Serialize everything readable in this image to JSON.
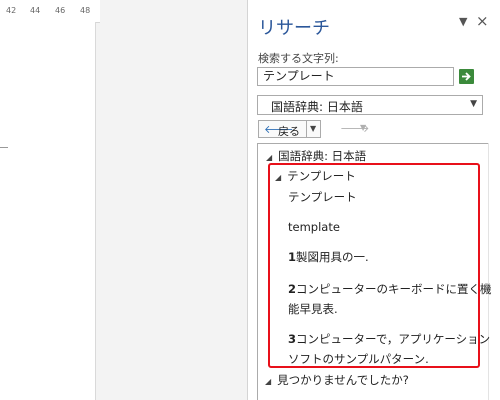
{
  "ruler": {
    "ticks": [
      "42",
      "44",
      "46",
      "48"
    ]
  },
  "pane": {
    "title": "リサーチ",
    "menu_glyph": "▼",
    "close_glyph": "×"
  },
  "search": {
    "label": "検索する文字列:",
    "value": "テンプレート"
  },
  "source": {
    "selected": "国語辞典: 日本語"
  },
  "nav": {
    "back_label": "戻る"
  },
  "results": {
    "section_title": "国語辞典: 日本語",
    "entry_title": "テンプレート",
    "entry_lines": [
      "テンプレート",
      "template"
    ],
    "definitions": [
      {
        "num": "1",
        "text": "製図用具の一."
      },
      {
        "num": "2",
        "text": "コンピューターのキーボードに置く機",
        "cont": "能早見表."
      },
      {
        "num": "3",
        "text": "コンピューターで，アプリケーション",
        "cont": "ソフトのサンプルパターン."
      }
    ],
    "not_found": "見つかりませんでしたか?"
  },
  "colors": {
    "accent": "#2b579a",
    "go_button": "#3b8a3b",
    "highlight_border": "#e8101a"
  }
}
